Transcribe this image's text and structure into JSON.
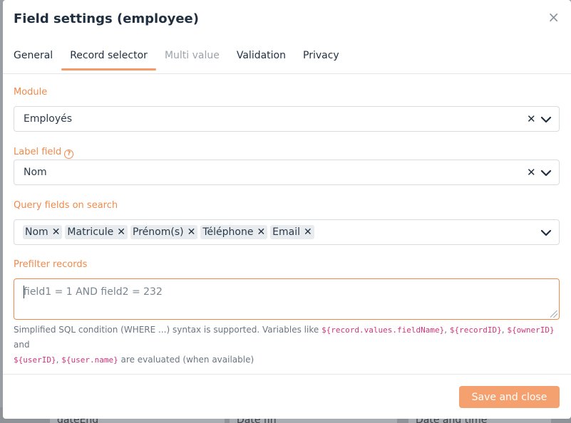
{
  "background": {
    "cells": [
      "dateEnd",
      "Date fin",
      "Date and time"
    ]
  },
  "modal": {
    "title": "Field settings (employee)",
    "close_glyph": "×"
  },
  "tabs": [
    {
      "label": "General",
      "state": "normal"
    },
    {
      "label": "Record selector",
      "state": "active"
    },
    {
      "label": "Multi value",
      "state": "disabled"
    },
    {
      "label": "Validation",
      "state": "normal"
    },
    {
      "label": "Privacy",
      "state": "normal"
    }
  ],
  "module": {
    "label": "Module",
    "value": "Employés"
  },
  "label_field": {
    "label": "Label field",
    "help_glyph": "?",
    "value": "Nom"
  },
  "query_fields": {
    "label": "Query fields on search",
    "chips": [
      "Nom",
      "Matricule",
      "Prénom(s)",
      "Téléphone",
      "Email"
    ]
  },
  "prefilter": {
    "label": "Prefilter records",
    "placeholder": "field1 = 1 AND field2 = 232",
    "help": {
      "p1": "Simplified SQL condition (WHERE ...) syntax is supported. Variables like ",
      "c1": "${record.values.fieldName}",
      "s1": ", ",
      "c2": "${recordID}",
      "s2": ", ",
      "c3": "${ownerID}",
      "p2": " and",
      "c4": "${userID}",
      "s3": ", ",
      "c5": "${user.name}",
      "p3": " are evaluated (when available)"
    }
  },
  "footer": {
    "save_label": "Save and close"
  },
  "colors": {
    "accent": "#f08a4b",
    "button": "#f4a06f",
    "code": "#d6337a"
  },
  "icons": {
    "clear": "x-icon",
    "dropdown": "chevron-down-icon",
    "close": "close-icon",
    "help": "question-circle-icon"
  }
}
